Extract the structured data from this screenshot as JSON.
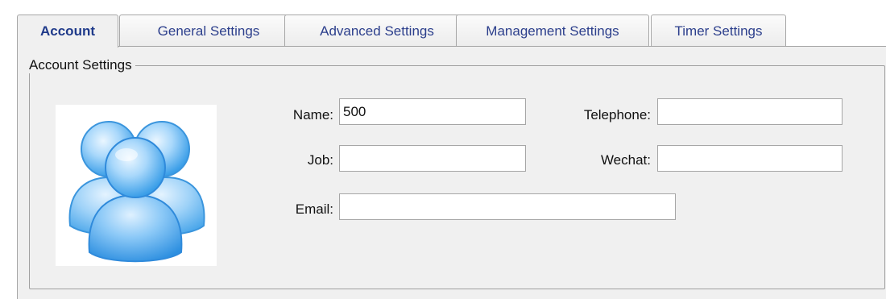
{
  "tabs": [
    {
      "label": "Account",
      "active": true
    },
    {
      "label": "General Settings",
      "active": false
    },
    {
      "label": "Advanced Settings",
      "active": false
    },
    {
      "label": "Management Settings",
      "active": false
    },
    {
      "label": "Timer Settings",
      "active": false
    }
  ],
  "account_settings": {
    "group_title": "Account Settings",
    "avatar_icon": "users-group-icon",
    "fields": {
      "name": {
        "label": "Name:",
        "value": "500"
      },
      "telephone": {
        "label": "Telephone:",
        "value": ""
      },
      "job": {
        "label": "Job:",
        "value": ""
      },
      "wechat": {
        "label": "Wechat:",
        "value": ""
      },
      "email": {
        "label": "Email:",
        "value": ""
      }
    }
  },
  "colors": {
    "tab_text": "#2c3f8c",
    "panel_background": "#f0f0f0",
    "border": "#a6a6a6",
    "avatar_blue": "#3a9ee8"
  }
}
